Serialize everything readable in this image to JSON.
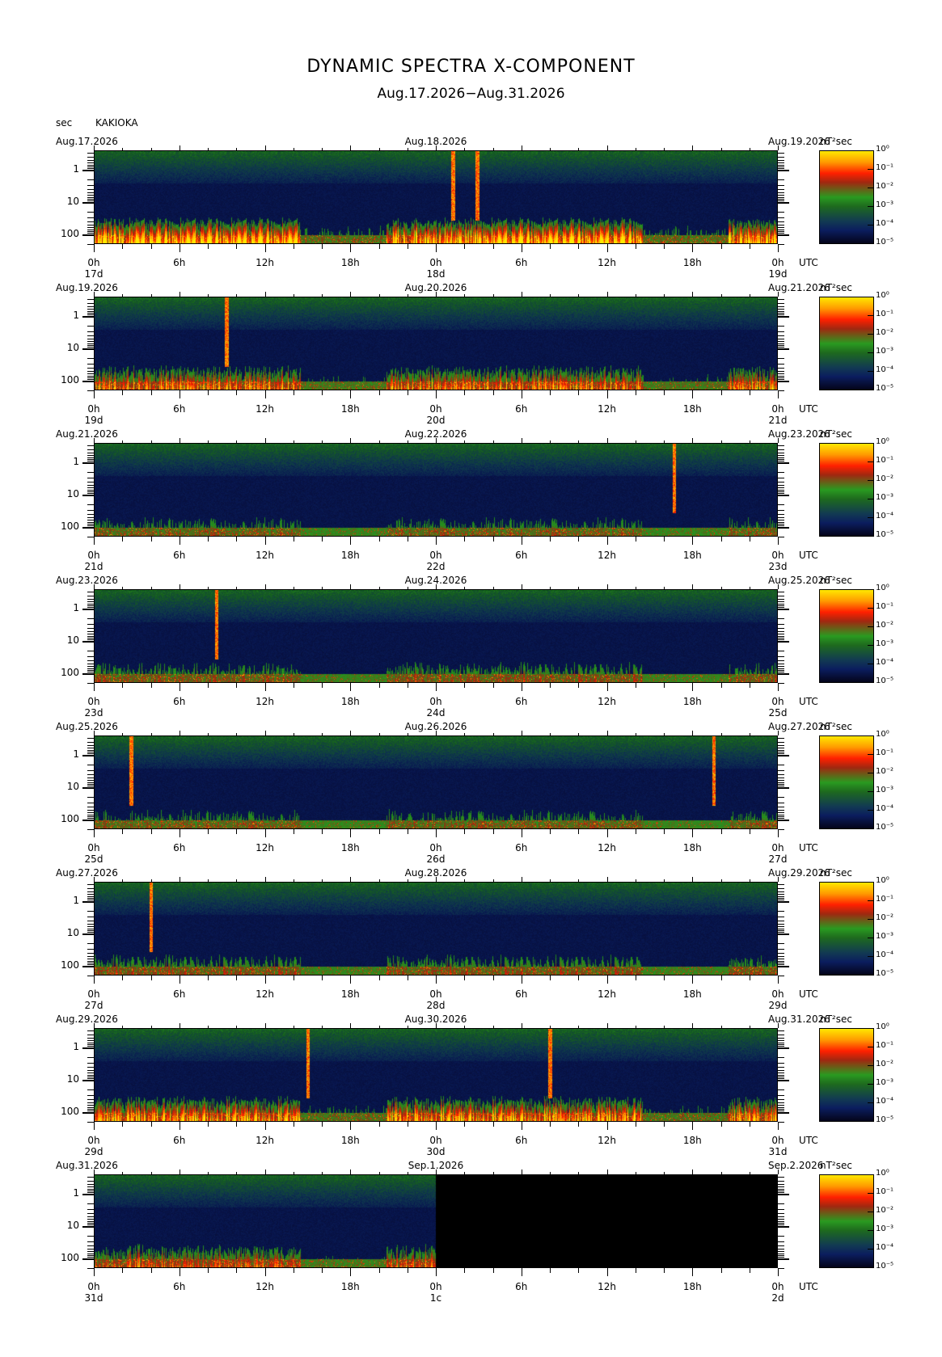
{
  "title": "DYNAMIC SPECTRA X-COMPONENT",
  "subtitle": "Aug.17.2026−Aug.31.2026",
  "station": "KAKIOKA",
  "y_unit": "sec",
  "colorbar_unit": "nT²sec",
  "colorbar_ticks": [
    "10⁰",
    "10⁻¹",
    "10⁻²",
    "10⁻³",
    "10⁻⁴",
    "10⁻⁵"
  ],
  "x_axis_unit": "UTC",
  "hour_ticks": [
    "0h",
    "6h",
    "12h",
    "18h",
    "0h",
    "6h",
    "12h",
    "18h",
    "0h"
  ],
  "period_ticks": [
    "1",
    "10",
    "100"
  ],
  "colors": {
    "low": "#04041a",
    "mid_low": "#123a52",
    "mid": "#2a9a20",
    "high": "#ff2000",
    "max": "#ffe800"
  },
  "chart_data": {
    "type": "heatmap",
    "title": "DYNAMIC SPECTRA X-COMPONENT",
    "subtitle": "Aug.17.2026−Aug.31.2026",
    "xlabel": "UTC",
    "ylabel": "sec",
    "y_scale": "log",
    "y_ticks": [
      1,
      10,
      100
    ],
    "colorbar_label": "nT²sec",
    "colorbar_range_log10": [
      -5,
      0
    ],
    "panels": [
      {
        "date_left": "Aug.17.2026",
        "date_mid": "Aug.18.2026",
        "date_right": "Aug.19.2026",
        "day_left": "17d",
        "day_mid": "18d",
        "day_right": "19d",
        "events": [
          {
            "hour": 25.2,
            "period_top_sec": 0.3
          },
          {
            "hour": 26.9,
            "period_top_sec": 0.3
          }
        ],
        "activity": 0.75,
        "data_until_hour": 48
      },
      {
        "date_left": "Aug.19.2026",
        "date_mid": "Aug.20.2026",
        "date_right": "Aug.21.2026",
        "day_left": "19d",
        "day_mid": "20d",
        "day_right": "21d",
        "events": [
          {
            "hour": 9.3,
            "period_top_sec": 0.2
          }
        ],
        "activity": 0.65,
        "data_until_hour": 48
      },
      {
        "date_left": "Aug.21.2026",
        "date_mid": "Aug.22.2026",
        "date_right": "Aug.23.2026",
        "day_left": "21d",
        "day_mid": "22d",
        "day_right": "23d",
        "events": [
          {
            "hour": 40.7,
            "period_top_sec": 0.3
          }
        ],
        "activity": 0.45,
        "data_until_hour": 48
      },
      {
        "date_left": "Aug.23.2026",
        "date_mid": "Aug.24.2026",
        "date_right": "Aug.25.2026",
        "day_left": "23d",
        "day_mid": "24d",
        "day_right": "25d",
        "events": [
          {
            "hour": 8.6,
            "period_top_sec": 0.2
          }
        ],
        "activity": 0.5,
        "data_until_hour": 48
      },
      {
        "date_left": "Aug.25.2026",
        "date_mid": "Aug.26.2026",
        "date_right": "Aug.27.2026",
        "day_left": "25d",
        "day_mid": "26d",
        "day_right": "27d",
        "events": [
          {
            "hour": 2.6,
            "period_top_sec": 0.2
          },
          {
            "hour": 43.5,
            "period_top_sec": 0.2
          }
        ],
        "activity": 0.45,
        "data_until_hour": 48
      },
      {
        "date_left": "Aug.27.2026",
        "date_mid": "Aug.28.2026",
        "date_right": "Aug.29.2026",
        "day_left": "27d",
        "day_mid": "28d",
        "day_right": "29d",
        "events": [
          {
            "hour": 4.0,
            "period_top_sec": 0.2
          }
        ],
        "activity": 0.5,
        "data_until_hour": 48
      },
      {
        "date_left": "Aug.29.2026",
        "date_mid": "Aug.30.2026",
        "date_right": "Aug.31.2026",
        "day_left": "29d",
        "day_mid": "30d",
        "day_right": "31d",
        "events": [
          {
            "hour": 15.0,
            "period_top_sec": 0.3
          },
          {
            "hour": 32.0,
            "period_top_sec": 0.3
          }
        ],
        "activity": 0.7,
        "data_until_hour": 48
      },
      {
        "date_left": "Aug.31.2026",
        "date_mid": "Sep.1.2026",
        "date_right": "Sep.2.2026",
        "day_left": "31d",
        "day_mid": "1c",
        "day_right": "2d",
        "events": [],
        "activity": 0.6,
        "data_until_hour": 24
      }
    ]
  }
}
